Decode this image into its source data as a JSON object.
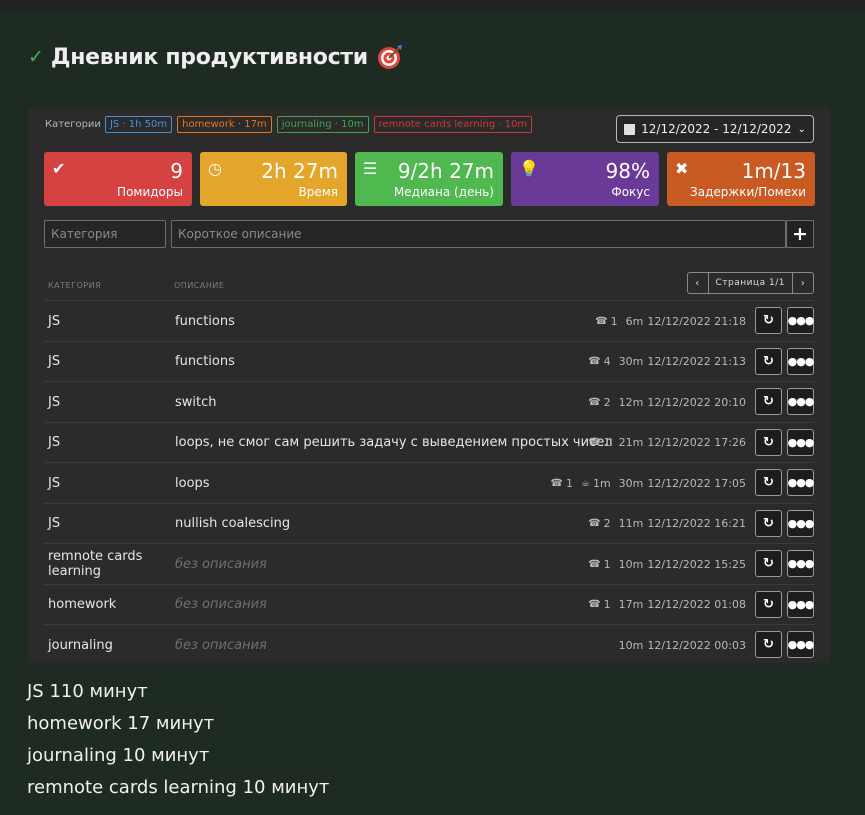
{
  "title": "Дневник продуктивности",
  "categories_label": "Категории",
  "chips": [
    {
      "text": "JS · 1h 50m",
      "color": "#4a90d9"
    },
    {
      "text": "homework · 17m",
      "color": "#e8761e"
    },
    {
      "text": "journaling · 10m",
      "color": "#3fa34d"
    },
    {
      "text": "remnote cards learning · 10m",
      "color": "#c9393a"
    }
  ],
  "date_range": "12/12/2022 - 12/12/2022",
  "stats": [
    {
      "icon": "✔",
      "icon_name": "check-circle-icon",
      "value": "9",
      "label": "Помидоры",
      "color": "#d64242"
    },
    {
      "icon": "◷",
      "icon_name": "clock-icon",
      "value": "2h 27m",
      "label": "Время",
      "color": "#e3a52a"
    },
    {
      "icon": "☰",
      "icon_name": "list-icon",
      "value": "9/2h 27m",
      "label": "Медиана (день)",
      "color": "#4fb84f"
    },
    {
      "icon": "💡",
      "icon_name": "lightbulb-icon",
      "value": "98%",
      "label": "Фокус",
      "color": "#6a3a99"
    },
    {
      "icon": "✖",
      "icon_name": "times-icon",
      "value": "1m/13",
      "label": "Задержки/Помехи",
      "color": "#c85a22"
    }
  ],
  "inputs": {
    "category_placeholder": "Категория",
    "description_placeholder": "Короткое описание",
    "add_label": "+"
  },
  "table": {
    "col_category": "КАТЕГОРИЯ",
    "col_description": "ОПИСАНИЕ",
    "page_text": "Страница 1/1",
    "rows": [
      {
        "category": "JS",
        "description": "functions",
        "calls": "1",
        "breaks": "",
        "duration": "6m",
        "datetime": "12/12/2022 21:18",
        "empty": false
      },
      {
        "category": "JS",
        "description": "functions",
        "calls": "4",
        "breaks": "",
        "duration": "30m",
        "datetime": "12/12/2022 21:13",
        "empty": false
      },
      {
        "category": "JS",
        "description": "switch",
        "calls": "2",
        "breaks": "",
        "duration": "12m",
        "datetime": "12/12/2022 20:10",
        "empty": false
      },
      {
        "category": "JS",
        "description": "loops, не смог сам решить задачу с выведением простых чисел",
        "calls": "1",
        "breaks": "",
        "duration": "21m",
        "datetime": "12/12/2022 17:26",
        "empty": false
      },
      {
        "category": "JS",
        "description": "loops",
        "calls": "1",
        "breaks": "1m",
        "duration": "30m",
        "datetime": "12/12/2022 17:05",
        "empty": false
      },
      {
        "category": "JS",
        "description": "nullish coalescing",
        "calls": "2",
        "breaks": "",
        "duration": "11m",
        "datetime": "12/12/2022 16:21",
        "empty": false
      },
      {
        "category": "remnote cards learning",
        "description": "без описания",
        "calls": "1",
        "breaks": "",
        "duration": "10m",
        "datetime": "12/12/2022 15:25",
        "empty": true
      },
      {
        "category": "homework",
        "description": "без описания",
        "calls": "1",
        "breaks": "",
        "duration": "17m",
        "datetime": "12/12/2022 01:08",
        "empty": true
      },
      {
        "category": "journaling",
        "description": "без описания",
        "calls": "",
        "breaks": "",
        "duration": "10m",
        "datetime": "12/12/2022 00:03",
        "empty": true
      }
    ]
  },
  "summary": [
    "JS 110 минут",
    "homework 17 минут",
    "journaling 10 минут",
    "remnote cards learning 10 минут"
  ]
}
